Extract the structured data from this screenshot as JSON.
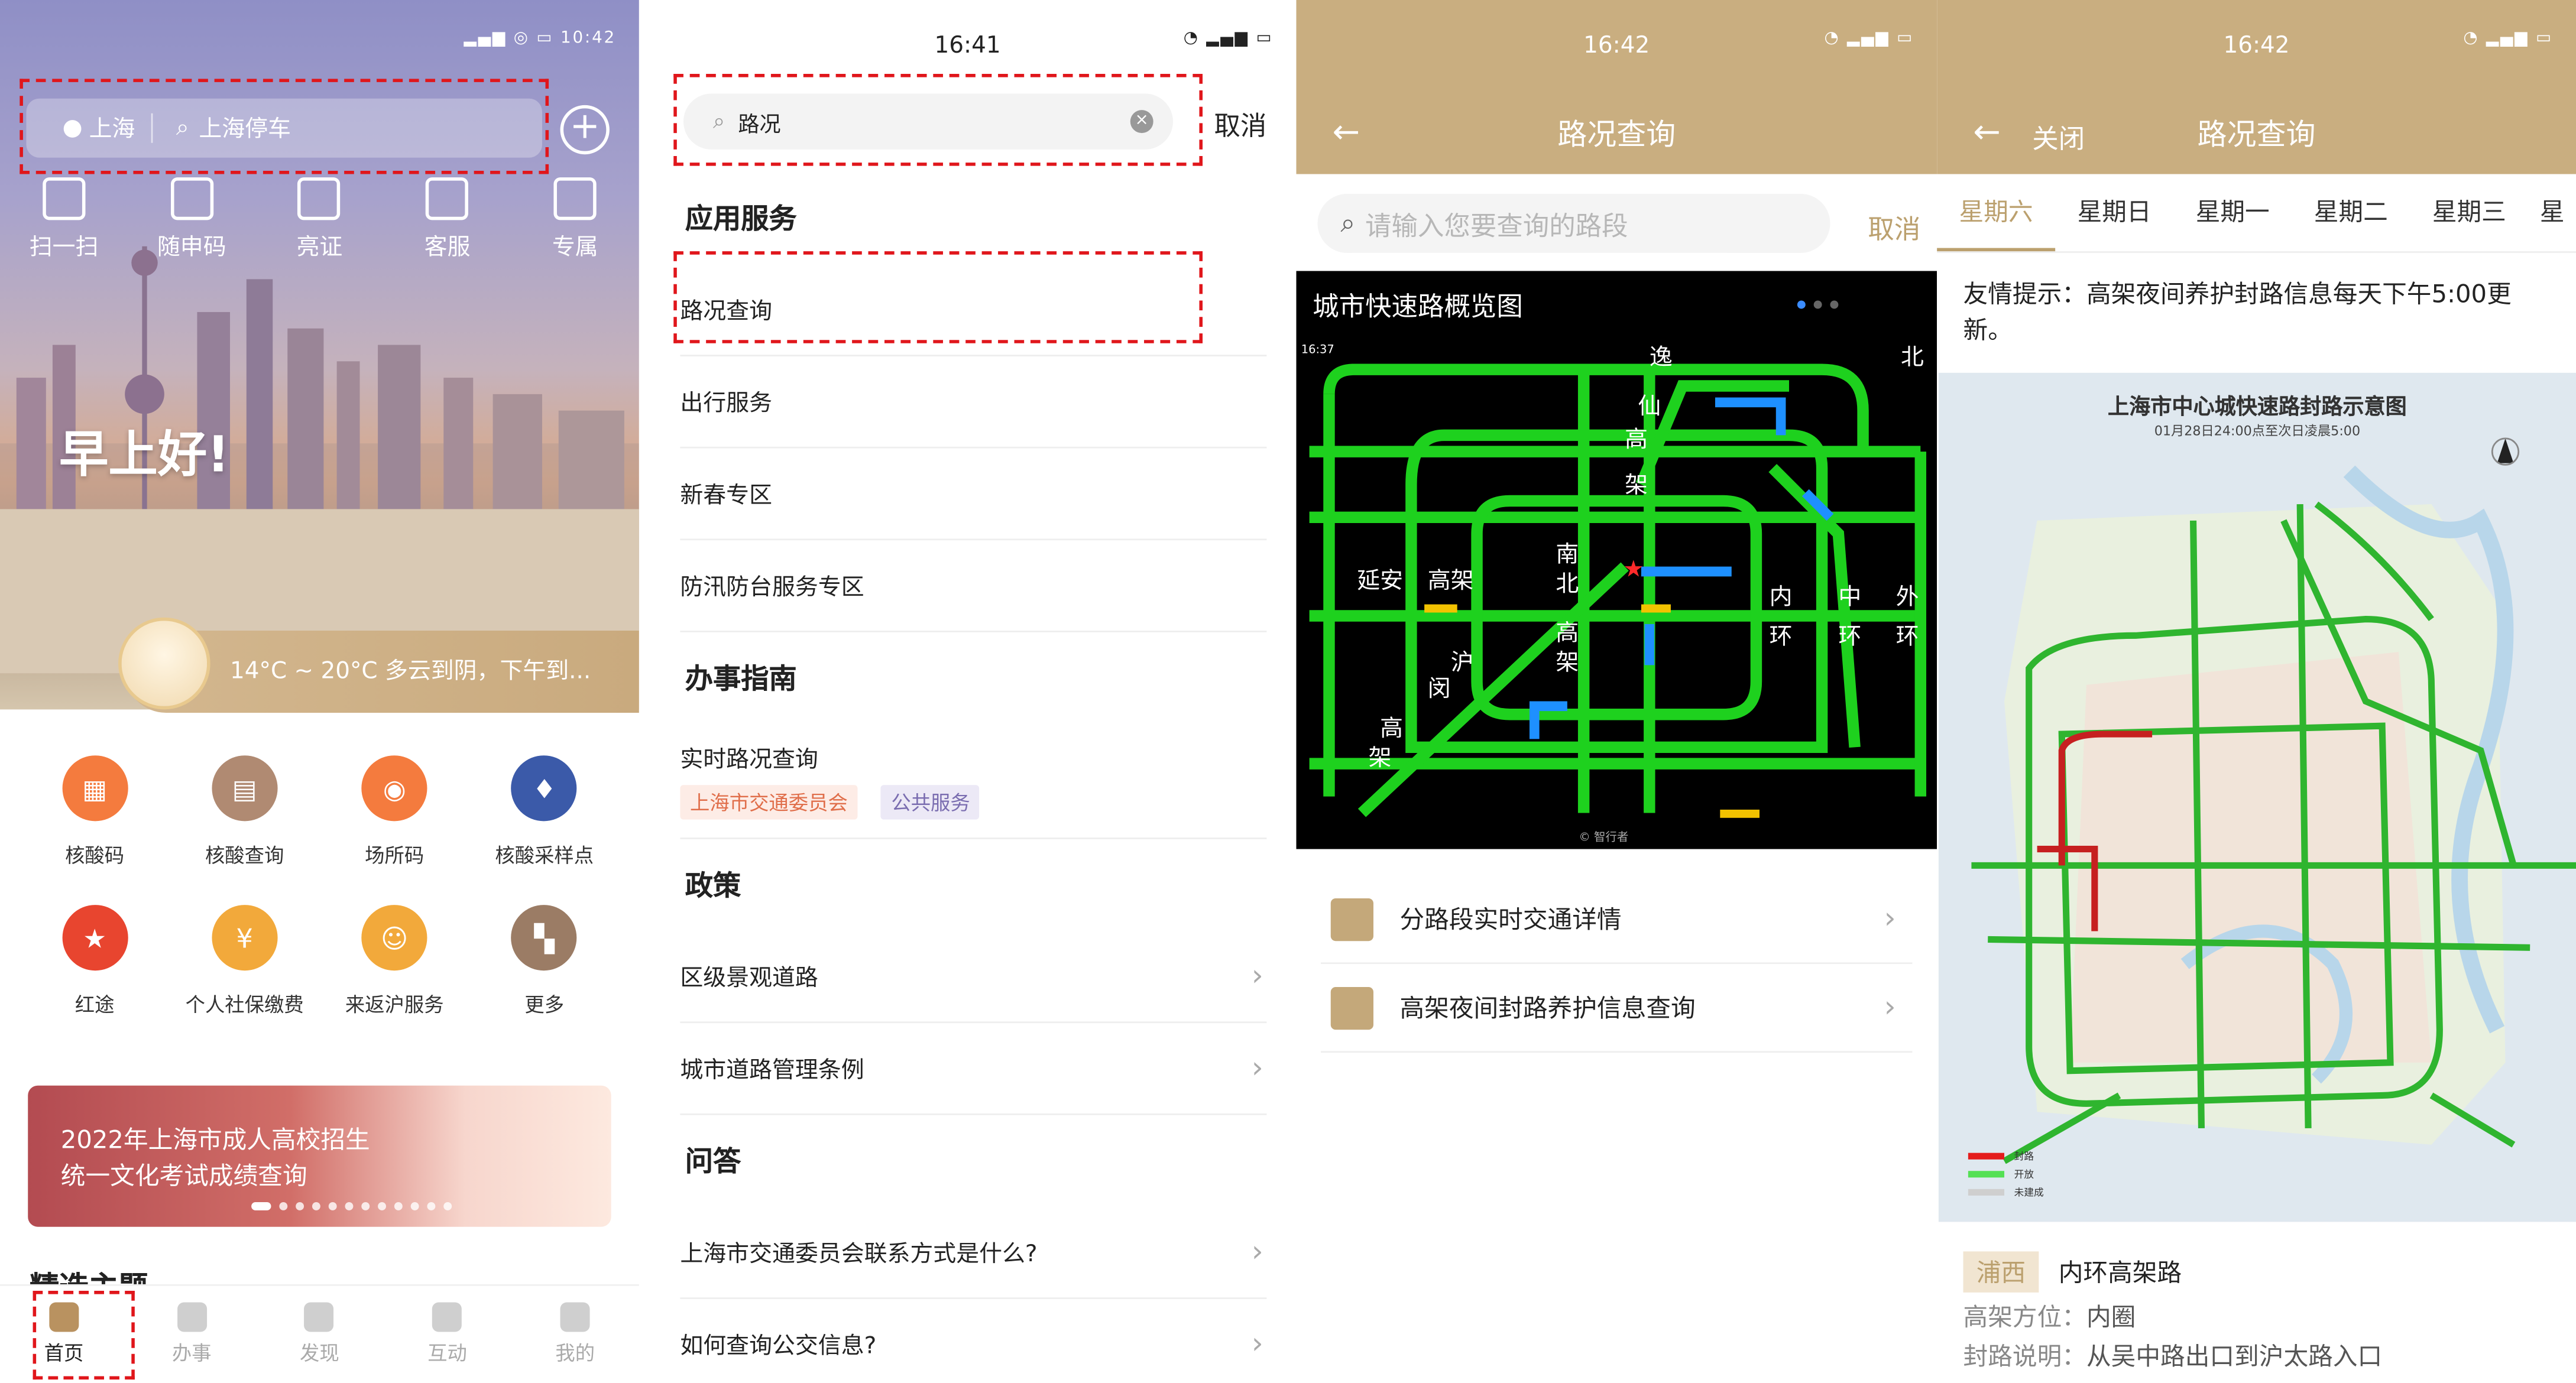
{
  "colors": {
    "gold": "#c9ae80",
    "accent": "#bba06e",
    "highlight_dash": "#e0161b",
    "map_green": "#1ed11e",
    "map_blue": "#1e90ff"
  },
  "p1": {
    "status_time": "10:42",
    "city": "上海",
    "search_placeholder": "上海停车",
    "quick": [
      "扫一扫",
      "随申码",
      "亮证",
      "客服",
      "专属"
    ],
    "greeting": "早上好!",
    "weather": "14°C ~ 20°C  多云到阴，下午到...",
    "grid": [
      {
        "label": "核酸码",
        "color": "#f47b3e",
        "icon": "qr-icon"
      },
      {
        "label": "核酸查询",
        "color": "#b08a72",
        "icon": "document-icon"
      },
      {
        "label": "场所码",
        "color": "#f47b3e",
        "icon": "location-icon"
      },
      {
        "label": "核酸采样点",
        "color": "#3b5aa9",
        "icon": "sample-point-icon"
      },
      {
        "label": "红途",
        "color": "#e8452f",
        "icon": "star-icon"
      },
      {
        "label": "个人社保缴费",
        "color": "#f2a93b",
        "icon": "payment-icon"
      },
      {
        "label": "来返沪服务",
        "color": "#f2a93b",
        "icon": "person-icon"
      },
      {
        "label": "更多",
        "color": "#9b7c65",
        "icon": "more-icon"
      }
    ],
    "banner_line1": "2022年上海市成人高校招生",
    "banner_line2": "统一文化考试成绩查询",
    "section_title": "精选主题",
    "tabs": [
      "首页",
      "办事",
      "发现",
      "互动",
      "我的"
    ]
  },
  "p2": {
    "status_time": "16:41",
    "search_value": "路况",
    "cancel": "取消",
    "cat_services": "应用服务",
    "services": [
      "路况查询",
      "出行服务",
      "新春专区",
      "防汛防台服务专区"
    ],
    "cat_guide": "办事指南",
    "guide_item": "实时路况查询",
    "guide_tags": [
      "上海市交通委员会",
      "公共服务"
    ],
    "cat_policy": "政策",
    "policies": [
      "区级景观道路",
      "城市道路管理条例"
    ],
    "cat_qa": "问答",
    "qa": [
      "上海市交通委员会联系方式是什么?",
      "如何查询公交信息?"
    ]
  },
  "p3": {
    "status_time": "16:42",
    "title": "路况查询",
    "search_placeholder": "请输入您要查询的路段",
    "cancel": "取消",
    "map_title": "城市快速路概览图",
    "map_time": "16:37",
    "map_labels": [
      "逸",
      "仙",
      "高",
      "架",
      "延安",
      "高架",
      "南",
      "北",
      "高",
      "架",
      "沪",
      "闵",
      "高",
      "架",
      "内",
      "环",
      "中",
      "环",
      "外",
      "环",
      "北"
    ],
    "map_credit": "© 智行者",
    "links": [
      "分路段实时交通详情",
      "高架夜间封路养护信息查询"
    ]
  },
  "p4": {
    "status_time": "16:42",
    "close": "关闭",
    "title": "路况查询",
    "days": [
      "星期六",
      "星期日",
      "星期一",
      "星期二",
      "星期三",
      "星"
    ],
    "tip": "友情提示：高架夜间养护封路信息每天下午5:00更新。",
    "map_title": "上海市中心城快速路封路示意图",
    "map_subtitle": "01月28日24:00点至次日凌晨5:00",
    "legend": [
      "封路",
      "开放",
      "未建成"
    ],
    "road_badge": "浦西",
    "road_name": "内环高架路",
    "direction_label": "高架方位：",
    "direction_value": "内圈",
    "closure_label": "封路说明：",
    "closure_value": "从吴中路出口到沪太路入口"
  }
}
